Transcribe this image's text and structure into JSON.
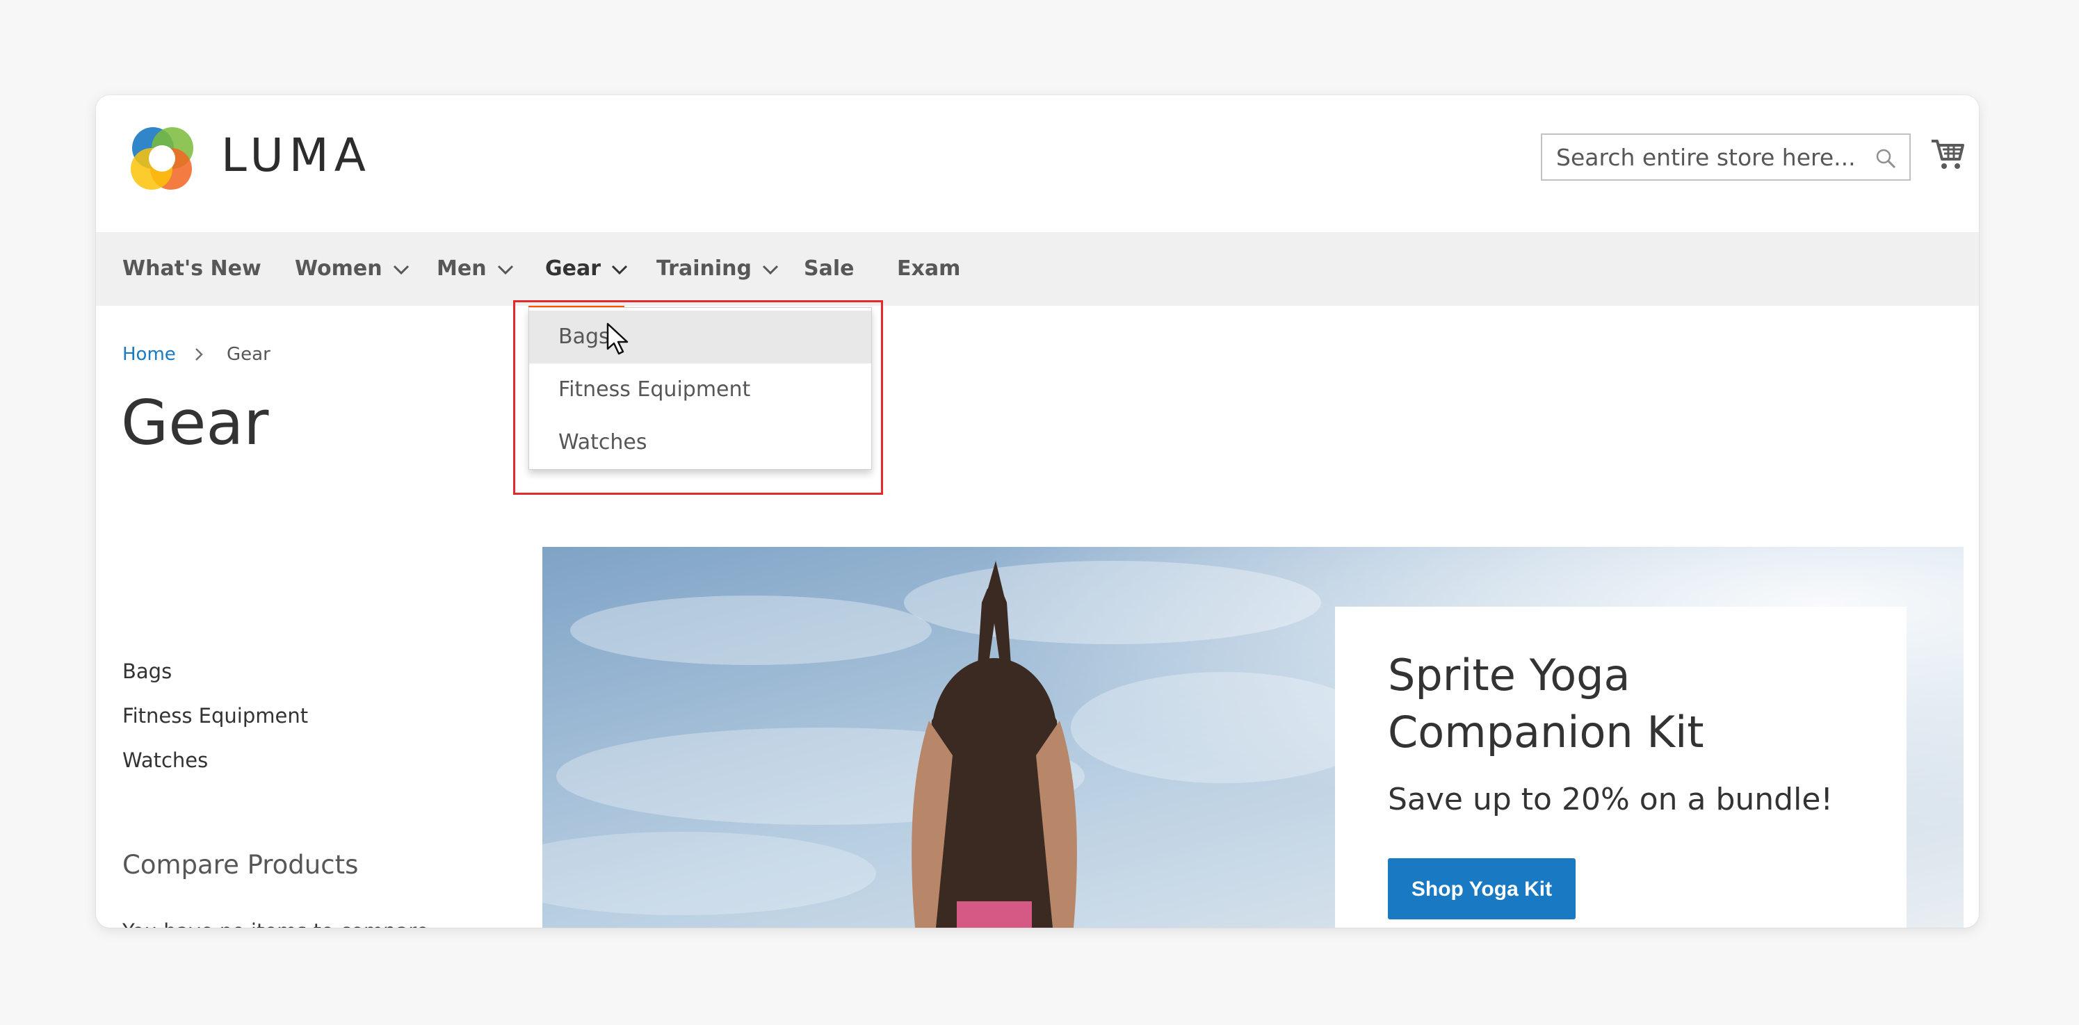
{
  "brand": {
    "name": "LUMA"
  },
  "search": {
    "placeholder": "Search entire store here..."
  },
  "nav": {
    "items": [
      {
        "label": "What's New"
      },
      {
        "label": "Women"
      },
      {
        "label": "Men"
      },
      {
        "label": "Gear"
      },
      {
        "label": "Training"
      },
      {
        "label": "Sale"
      },
      {
        "label": "Exam"
      }
    ],
    "active": "Gear"
  },
  "dropdown": {
    "items": [
      {
        "label": "Bags"
      },
      {
        "label": "Fitness Equipment"
      },
      {
        "label": "Watches"
      }
    ],
    "hovered": "Bags"
  },
  "breadcrumb": {
    "home": "Home",
    "current": "Gear"
  },
  "page": {
    "title": "Gear"
  },
  "sidebar": {
    "categories": [
      {
        "label": "Bags"
      },
      {
        "label": "Fitness Equipment"
      },
      {
        "label": "Watches"
      }
    ],
    "compare_title": "Compare Products",
    "compare_empty": "You have no items to compare."
  },
  "banner": {
    "title": "Sprite Yoga Companion Kit",
    "subtitle": "Save up to 20% on a bundle!",
    "cta": "Shop Yoga Kit"
  },
  "colors": {
    "accent": "#ff5501",
    "link": "#1979c3",
    "button": "#1979c3",
    "highlight": "#e5282b"
  }
}
